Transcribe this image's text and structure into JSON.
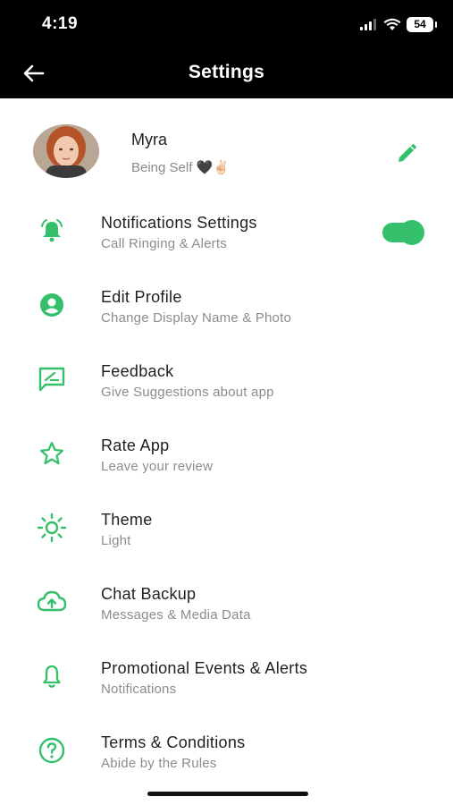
{
  "status_bar": {
    "time": "4:19",
    "battery": "54"
  },
  "nav": {
    "title": "Settings"
  },
  "profile": {
    "name": "Myra",
    "status": "Being Self 🖤✌🏻"
  },
  "colors": {
    "accent": "#34c06a",
    "header_bg": "#000000"
  },
  "menu": [
    {
      "title": "Notifications Settings",
      "subtitle": "Call Ringing & Alerts",
      "icon": "alarm-bell-icon",
      "toggle": true
    },
    {
      "title": "Edit Profile",
      "subtitle": "Change Display Name & Photo",
      "icon": "account-circle-icon"
    },
    {
      "title": "Feedback",
      "subtitle": "Give Suggestions about app",
      "icon": "feedback-icon"
    },
    {
      "title": "Rate App",
      "subtitle": "Leave your review",
      "icon": "star-icon"
    },
    {
      "title": "Theme",
      "subtitle": "Light",
      "icon": "sun-icon"
    },
    {
      "title": "Chat Backup",
      "subtitle": "Messages & Media Data",
      "icon": "cloud-upload-icon"
    },
    {
      "title": "Promotional Events & Alerts",
      "subtitle": "Notifications",
      "icon": "bell-icon"
    },
    {
      "title": "Terms & Conditions",
      "subtitle": "Abide by the Rules",
      "icon": "help-circle-icon"
    }
  ]
}
